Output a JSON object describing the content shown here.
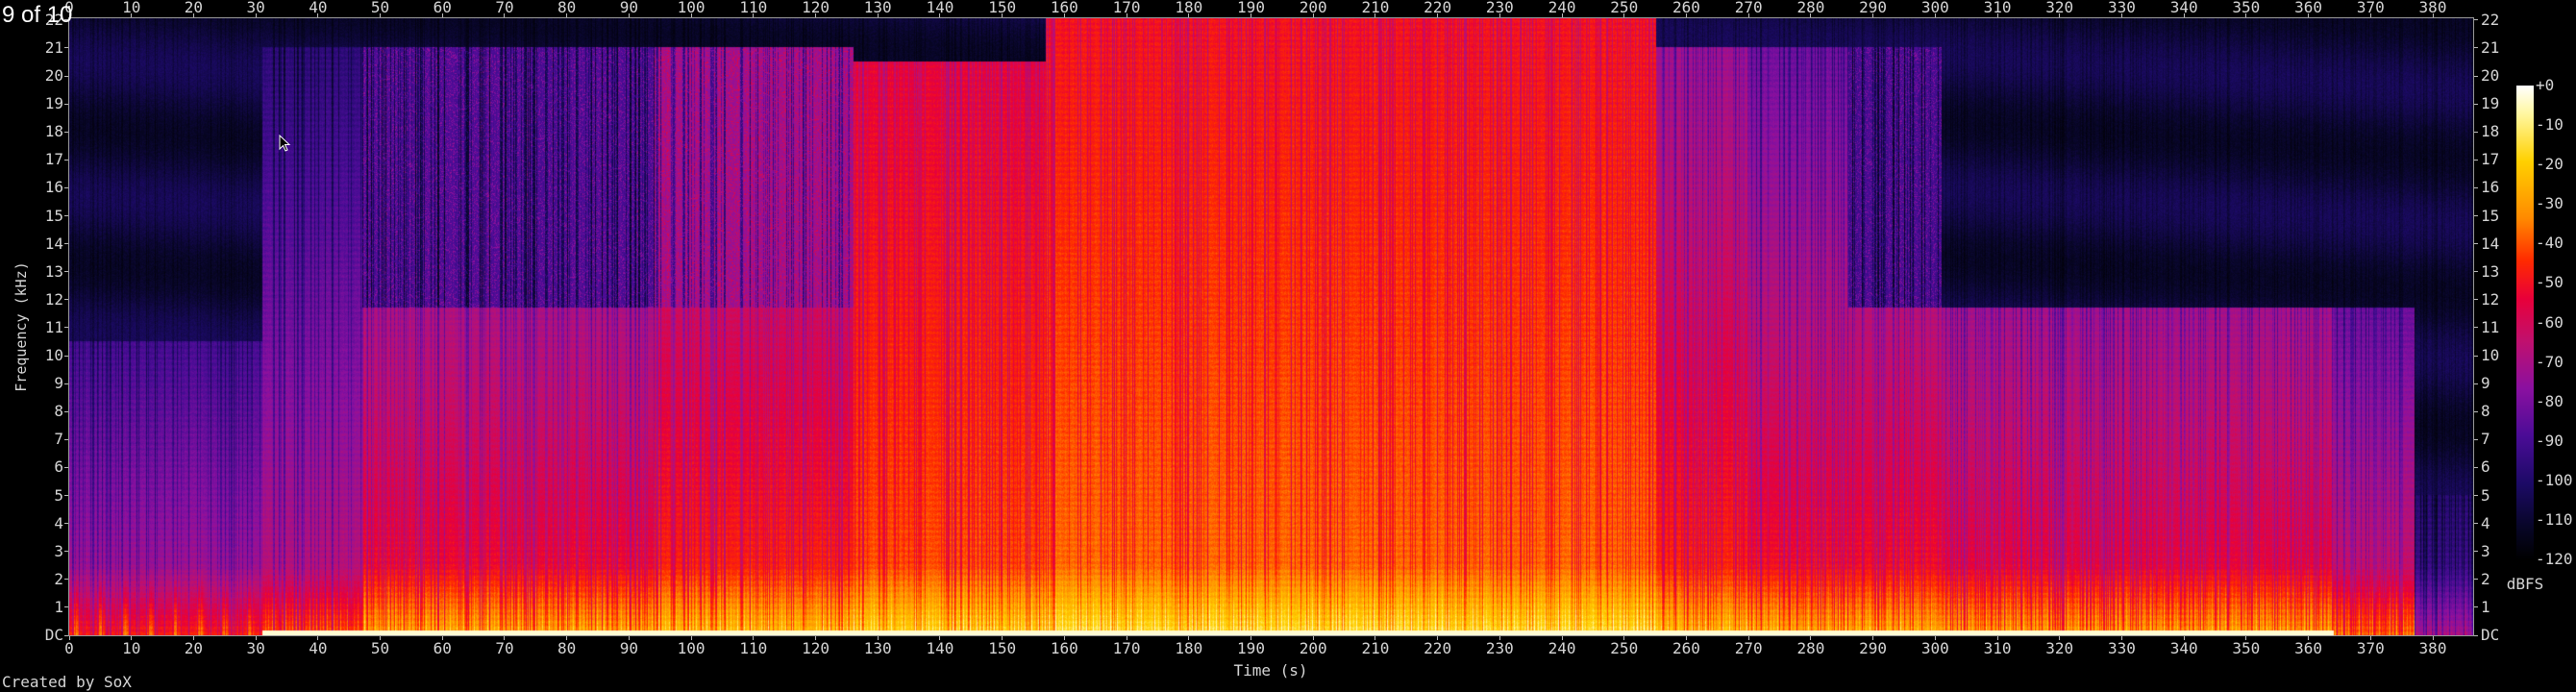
{
  "viewer": {
    "counter": "9 of 10"
  },
  "footer": {
    "credit": "Created by SoX"
  },
  "colors": {
    "background": "#000000",
    "axis": "#9a9a9a",
    "text": "#d6d6d6"
  },
  "chart_data": {
    "type": "heatmap",
    "subtype": "spectrogram",
    "xlabel": "Time (s)",
    "ylabel": "Frequency (kHz)",
    "x_ticks": [
      "0",
      "10",
      "20",
      "30",
      "40",
      "50",
      "60",
      "70",
      "80",
      "90",
      "100",
      "110",
      "120",
      "130",
      "140",
      "150",
      "160",
      "170",
      "180",
      "190",
      "200",
      "210",
      "220",
      "230",
      "240",
      "250",
      "260",
      "270",
      "280",
      "290",
      "300",
      "310",
      "320",
      "330",
      "340",
      "350",
      "360",
      "370",
      "380"
    ],
    "y_ticks": [
      "DC",
      "1",
      "2",
      "3",
      "4",
      "5",
      "6",
      "7",
      "8",
      "9",
      "10",
      "11",
      "12",
      "13",
      "14",
      "15",
      "16",
      "17",
      "18",
      "19",
      "20",
      "21",
      "22"
    ],
    "xlim": [
      0,
      386.5
    ],
    "ylim": [
      0,
      22.05
    ],
    "colorbar": {
      "label": "dBFS",
      "ticks": [
        "+0",
        "-10",
        "-20",
        "-30",
        "-40",
        "-50",
        "-60",
        "-70",
        "-80",
        "-90",
        "-100",
        "-110",
        "-120"
      ],
      "range": [
        -120,
        0
      ]
    },
    "segments": [
      {
        "start": 0,
        "end": 31,
        "cutoff_khz": 10.5,
        "upper_cutoff_khz": 10.5,
        "level_db": -64,
        "slope_db_per_khz": 2.2,
        "upper_db": -100
      },
      {
        "start": 31,
        "end": 47,
        "cutoff_khz": 21.0,
        "upper_cutoff_khz": 21.0,
        "level_db": -60,
        "slope_db_per_khz": 1.6,
        "upper_db": -100
      },
      {
        "start": 47,
        "end": 94,
        "cutoff_khz": 11.7,
        "upper_cutoff_khz": 21.0,
        "level_db": -46,
        "slope_db_per_khz": 1.7,
        "upper_db": -86
      },
      {
        "start": 94,
        "end": 126,
        "cutoff_khz": 11.7,
        "upper_cutoff_khz": 21.0,
        "level_db": -42,
        "slope_db_per_khz": 1.4,
        "upper_db": -70
      },
      {
        "start": 126,
        "end": 157,
        "cutoff_khz": 20.5,
        "upper_cutoff_khz": 20.5,
        "level_db": -38,
        "slope_db_per_khz": 0.7,
        "upper_db": -100
      },
      {
        "start": 157,
        "end": 255,
        "cutoff_khz": 22.05,
        "upper_cutoff_khz": 22.05,
        "level_db": -35,
        "slope_db_per_khz": 0.6,
        "upper_db": -100
      },
      {
        "start": 255,
        "end": 270,
        "cutoff_khz": 21.0,
        "upper_cutoff_khz": 21.0,
        "level_db": -42,
        "slope_db_per_khz": 1.3,
        "upper_db": -100
      },
      {
        "start": 270,
        "end": 286,
        "cutoff_khz": 21.0,
        "upper_cutoff_khz": 21.0,
        "level_db": -45,
        "slope_db_per_khz": 1.6,
        "upper_db": -100
      },
      {
        "start": 286,
        "end": 301,
        "cutoff_khz": 11.7,
        "upper_cutoff_khz": 21.0,
        "level_db": -45,
        "slope_db_per_khz": 1.6,
        "upper_db": -88
      },
      {
        "start": 301,
        "end": 364,
        "cutoff_khz": 11.7,
        "upper_cutoff_khz": 11.7,
        "level_db": -48,
        "slope_db_per_khz": 1.7,
        "upper_db": -102
      },
      {
        "start": 364,
        "end": 377,
        "cutoff_khz": 11.7,
        "upper_cutoff_khz": 11.7,
        "level_db": -56,
        "slope_db_per_khz": 2.0,
        "upper_db": -102
      },
      {
        "start": 377,
        "end": 386.5,
        "cutoff_khz": 5.0,
        "upper_cutoff_khz": 5.0,
        "level_db": -85,
        "slope_db_per_khz": 2.0,
        "upper_db": -108
      }
    ]
  }
}
